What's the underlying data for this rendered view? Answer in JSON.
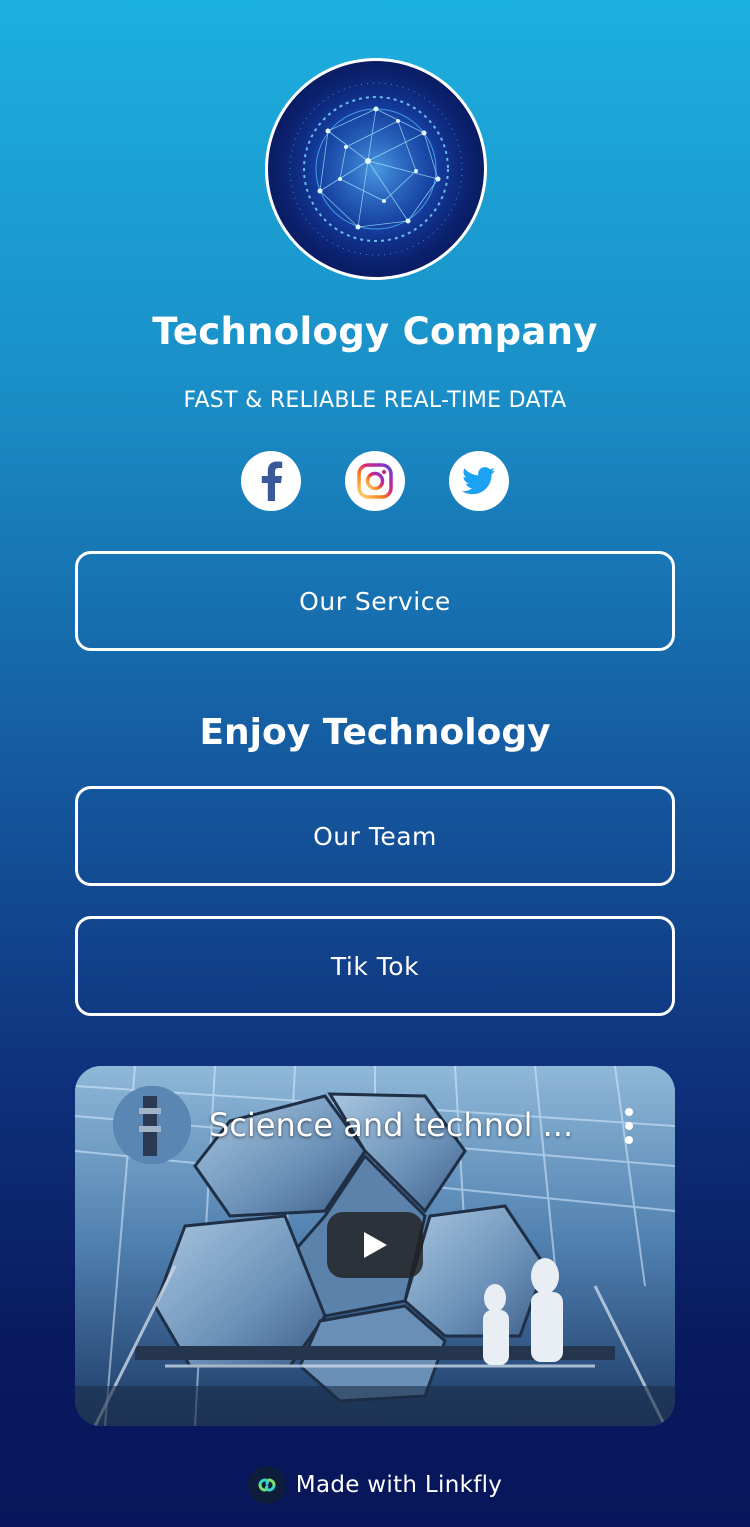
{
  "profile": {
    "name": "Technology Company",
    "tagline": "FAST & RELIABLE REAL-TIME DATA"
  },
  "socials": [
    {
      "name": "facebook",
      "icon": "facebook-icon",
      "color": "#3b5998"
    },
    {
      "name": "instagram",
      "icon": "instagram-icon",
      "color": "#c13584"
    },
    {
      "name": "twitter",
      "icon": "twitter-icon",
      "color": "#1da1f2"
    }
  ],
  "buttons": {
    "our_service": "Our Service",
    "our_team": "Our Team",
    "tik_tok": "Tik Tok"
  },
  "section_heading": "Enjoy Technology",
  "video": {
    "title": "Science and technol ..."
  },
  "footer": {
    "text": "Made with Linkfly"
  }
}
